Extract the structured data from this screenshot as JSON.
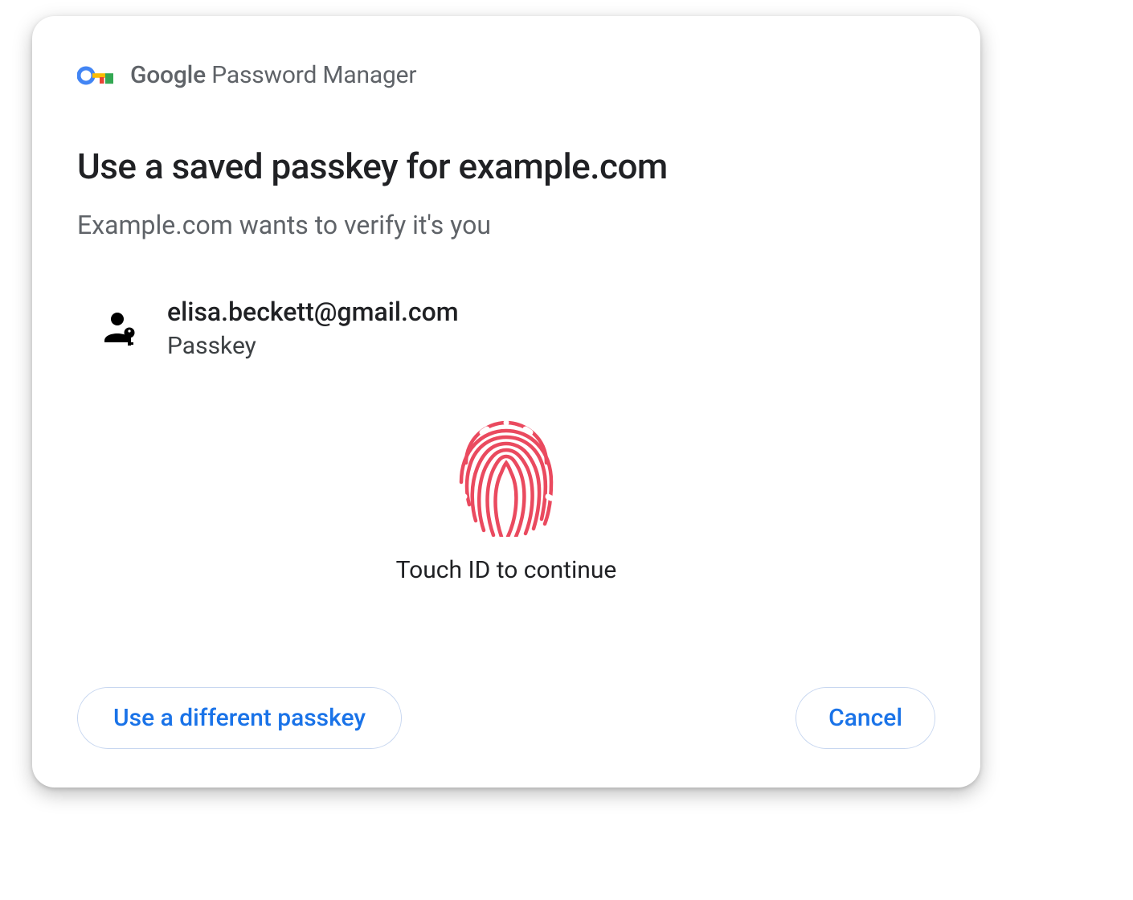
{
  "header": {
    "brand_google": "Google",
    "brand_product": " Password Manager"
  },
  "title": "Use a saved passkey for example.com",
  "subtitle": "Example.com wants to verify it's you",
  "account": {
    "email": "elisa.beckett@gmail.com",
    "type": "Passkey"
  },
  "touch": {
    "label": "Touch ID to continue"
  },
  "buttons": {
    "different": "Use a different passkey",
    "cancel": "Cancel"
  },
  "colors": {
    "blue": "#1a73e8",
    "fingerprint": "#ea4a5f"
  }
}
